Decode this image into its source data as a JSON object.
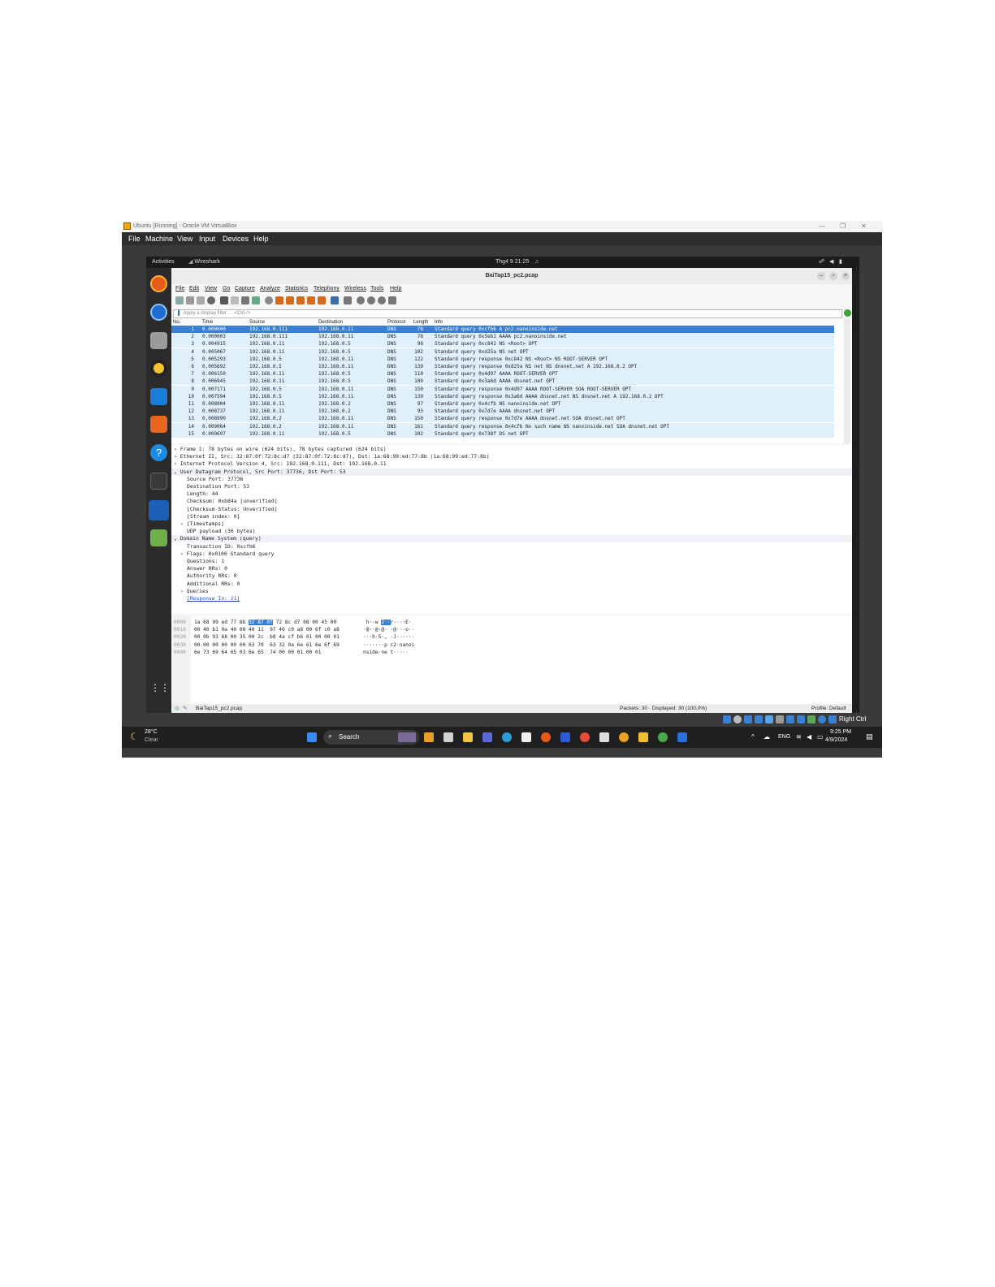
{
  "vbox": {
    "title": "Ubuntu [Running] - Oracle VM VirtualBox",
    "controls": {
      "minimize": "—",
      "restore": "❐",
      "close": "✕"
    },
    "menu": [
      "File",
      "Machine",
      "View",
      "Input",
      "Devices",
      "Help"
    ]
  },
  "ubuntu": {
    "activities": "Activities",
    "app_name": "Wireshark",
    "clock": "Thg4 9  21:25",
    "dock_icons": [
      "firefox-icon",
      "thunderbird-icon",
      "files-icon",
      "rhythmbox-icon",
      "writer-icon",
      "app-center-icon",
      "help-icon",
      "terminal-icon",
      "wireshark-icon",
      "trash-icon",
      "app-grid-icon"
    ]
  },
  "wireshark": {
    "title": "BaiTap15_pc2.pcap",
    "menu": [
      "File",
      "Edit",
      "View",
      "Go",
      "Capture",
      "Analyze",
      "Statistics",
      "Telephony",
      "Wireless",
      "Tools",
      "Help"
    ],
    "filter_placeholder": "Apply a display filter … <Ctrl-/>",
    "columns": [
      "No.",
      "Time",
      "Source",
      "Destination",
      "Protocol",
      "Length",
      "Info"
    ],
    "packets": [
      {
        "no": "1",
        "time": "0.000000",
        "src": "192.168.0.111",
        "dst": "192.168.0.11",
        "proto": "DNS",
        "len": "78",
        "info": "Standard query 0xcfb6 A pc2.nanoinside.net"
      },
      {
        "no": "2",
        "time": "0.000003",
        "src": "192.168.0.111",
        "dst": "192.168.0.11",
        "proto": "DNS",
        "len": "78",
        "info": "Standard query 0x5eb1 AAAA pc2.nanoinside.net"
      },
      {
        "no": "3",
        "time": "0.004915",
        "src": "192.168.0.11",
        "dst": "192.168.0.5",
        "proto": "DNS",
        "len": "98",
        "info": "Standard query 0xc842 NS <Root> OPT"
      },
      {
        "no": "4",
        "time": "0.005067",
        "src": "192.168.0.11",
        "dst": "192.168.0.5",
        "proto": "DNS",
        "len": "102",
        "info": "Standard query 0xd25a NS net OPT"
      },
      {
        "no": "5",
        "time": "0.005293",
        "src": "192.168.0.5",
        "dst": "192.168.0.11",
        "proto": "DNS",
        "len": "122",
        "info": "Standard query response 0xc842 NS <Root> NS ROOT-SERVER OPT"
      },
      {
        "no": "6",
        "time": "0.005692",
        "src": "192.168.0.5",
        "dst": "192.168.0.11",
        "proto": "DNS",
        "len": "139",
        "info": "Standard query response 0xd25a NS net NS dnsnet.net A 192.168.0.2 OPT"
      },
      {
        "no": "7",
        "time": "0.006150",
        "src": "192.168.0.11",
        "dst": "192.168.0.5",
        "proto": "DNS",
        "len": "110",
        "info": "Standard query 0x4d97 AAAA ROOT-SERVER OPT"
      },
      {
        "no": "8",
        "time": "0.006945",
        "src": "192.168.0.11",
        "dst": "192.168.0.5",
        "proto": "DNS",
        "len": "109",
        "info": "Standard query 0x3a6d AAAA dnsnet.net OPT"
      },
      {
        "no": "9",
        "time": "0.007171",
        "src": "192.168.0.5",
        "dst": "192.168.0.11",
        "proto": "DNS",
        "len": "150",
        "info": "Standard query response 0x4d97 AAAA ROOT-SERVER SOA ROOT-SERVER OPT"
      },
      {
        "no": "10",
        "time": "0.007594",
        "src": "192.168.0.5",
        "dst": "192.168.0.11",
        "proto": "DNS",
        "len": "139",
        "info": "Standard query response 0x3a6d AAAA dnsnet.net NS dnsnet.net A 192.168.0.2 OPT"
      },
      {
        "no": "11",
        "time": "0.008004",
        "src": "192.168.0.11",
        "dst": "192.168.0.2",
        "proto": "DNS",
        "len": "97",
        "info": "Standard query 0x4cfb NS nanoinside.net OPT"
      },
      {
        "no": "12",
        "time": "0.008737",
        "src": "192.168.0.11",
        "dst": "192.168.0.2",
        "proto": "DNS",
        "len": "93",
        "info": "Standard query 0x7d7e AAAA dnsnet.net OPT"
      },
      {
        "no": "13",
        "time": "0.008990",
        "src": "192.168.0.2",
        "dst": "192.168.0.11",
        "proto": "DNS",
        "len": "150",
        "info": "Standard query response 0x7d7e AAAA dnsnet.net SOA dnsnet.net OPT"
      },
      {
        "no": "14",
        "time": "0.009064",
        "src": "192.168.0.2",
        "dst": "192.168.0.11",
        "proto": "DNS",
        "len": "161",
        "info": "Standard query response 0x4cfb No such name NS nanoinside.net SOA dnsnet.net OPT"
      },
      {
        "no": "15",
        "time": "0.009697",
        "src": "192.168.0.11",
        "dst": "192.168.0.5",
        "proto": "DNS",
        "len": "102",
        "info": "Standard query 0x738f DS net OPT"
      }
    ],
    "details": [
      {
        "text": "› Frame 1: 78 bytes on wire (624 bits), 78 bytes captured (624 bits)",
        "indent": 0
      },
      {
        "text": "› Ethernet II, Src: 32:87:0f:72:8c:d7 (32:87:0f:72:8c:d7), Dst: 1a:68:99:ed:77:8b (1a:68:99:ed:77:8b)",
        "indent": 0
      },
      {
        "text": "› Internet Protocol Version 4, Src: 192.168.0.111, Dst: 192.168.0.11",
        "indent": 0
      },
      {
        "text": "⌄ User Datagram Protocol, Src Port: 37736, Dst Port: 53",
        "indent": 0,
        "hl": true
      },
      {
        "text": "Source Port: 37736",
        "indent": 2
      },
      {
        "text": "Destination Port: 53",
        "indent": 2
      },
      {
        "text": "Length: 44",
        "indent": 2
      },
      {
        "text": "Checksum: 0xb84a [unverified]",
        "indent": 2
      },
      {
        "text": "[Checksum Status: Unverified]",
        "indent": 2
      },
      {
        "text": "[Stream index: 0]",
        "indent": 2
      },
      {
        "text": "› [Timestamps]",
        "indent": 1
      },
      {
        "text": "UDP payload (36 bytes)",
        "indent": 2
      },
      {
        "text": "⌄ Domain Name System (query)",
        "indent": 0,
        "hl": true
      },
      {
        "text": "Transaction ID: 0xcfb6",
        "indent": 2
      },
      {
        "text": "› Flags: 0x0100 Standard query",
        "indent": 1
      },
      {
        "text": "Questions: 1",
        "indent": 2
      },
      {
        "text": "Answer RRs: 0",
        "indent": 2
      },
      {
        "text": "Authority RRs: 0",
        "indent": 2
      },
      {
        "text": "Additional RRs: 0",
        "indent": 2
      },
      {
        "text": "› Queries",
        "indent": 1
      },
      {
        "text": "[Response In: 21]",
        "indent": 2,
        "link": true
      }
    ],
    "bytes": [
      {
        "offset": "0000",
        "hex_a": "1a 68 99 ed 77 8b ",
        "hex_hl": "32 87 0f",
        "hex_b": " 72 8c d7 08 00 45 00",
        "ascii_a": " h··w ",
        "ascii_hl": "2··",
        "ascii_b": "r····E·"
      },
      {
        "offset": "0010",
        "hex_a": "00 40 b1 9a 40 00 40 11  97 40 c0 a8 00 6f c0 a8",
        "hex_hl": "",
        "hex_b": "",
        "ascii_a": "·@··@·@· ·@···o··",
        "ascii_hl": "",
        "ascii_b": ""
      },
      {
        "offset": "0020",
        "hex_a": "00 0b 93 68 00 35 00 2c  b8 4a cf b6 01 00 00 01",
        "hex_hl": "",
        "hex_b": "",
        "ascii_a": "···h·5·, ·J······",
        "ascii_hl": "",
        "ascii_b": ""
      },
      {
        "offset": "0030",
        "hex_a": "00 00 00 00 00 00 03 70  63 32 0a 6e 61 6e 6f 69",
        "hex_hl": "",
        "hex_b": "",
        "ascii_a": "·······p c2·nanoi",
        "ascii_hl": "",
        "ascii_b": ""
      },
      {
        "offset": "0040",
        "hex_a": "6e 73 69 64 65 03 6e 65  74 00 00 01 00 01",
        "hex_hl": "",
        "hex_b": "",
        "ascii_a": "nside·ne t·····",
        "ascii_hl": "",
        "ascii_b": ""
      }
    ],
    "status": {
      "file": "BaiTap15_pc2.pcap",
      "packets": "Packets: 30 · Displayed: 30 (100.0%)",
      "profile": "Profile: Default"
    }
  },
  "vbox_tray": {
    "host_key": "Right Ctrl"
  },
  "taskbar": {
    "weather_temp": "28°C",
    "weather_desc": "Clear",
    "search": "Search",
    "lang": "ENG",
    "time": "9:25 PM",
    "date": "4/9/2024"
  },
  "colors": {
    "selected_row": "#3a7fd1",
    "row_bg": "#dff0fb"
  }
}
